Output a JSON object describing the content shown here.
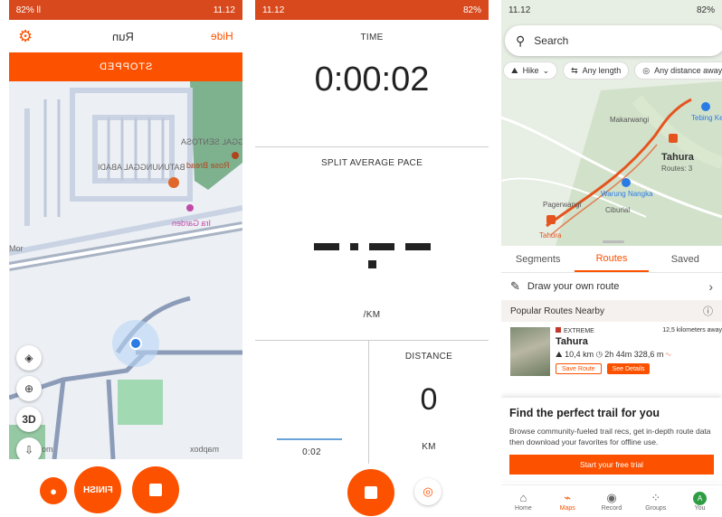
{
  "panel_record_map": {
    "status_left": "11.12",
    "status_right": "82% ll",
    "title": "Run",
    "hide_label": "Hide",
    "stopped_label": "STOPPED",
    "map_labels": {
      "area1": "KATUNUNGGAL SENTOSA",
      "area2": "BATUNUNGGAL ABADI",
      "poi1": "Rose Bread",
      "poi2": "Ira Garden",
      "road": "Mor",
      "poi3": "Telkom",
      "attribution": "mapbox"
    },
    "map_controls": [
      "layers",
      "locate",
      "3D",
      "compass"
    ],
    "finish_label": "FINISH"
  },
  "panel_record_stats": {
    "status_time": "11.12",
    "status_battery": "82%",
    "time_label": "TIME",
    "time_value": "0:00:02",
    "split_label": "SPLIT AVERAGE PACE",
    "pace_unit": "/KM",
    "distance_label": "DISTANCE",
    "distance_value": "0",
    "distance_unit": "KM",
    "split_time": "0:02"
  },
  "panel_maps": {
    "status_time": "11.12",
    "status_battery": "82%",
    "search_placeholder": "Search",
    "chips": [
      {
        "icon": "hike-icon",
        "label": "Hike"
      },
      {
        "icon": "length-icon",
        "label": "Any length"
      },
      {
        "icon": "distance-icon",
        "label": "Any distance away"
      }
    ],
    "map_labels": {
      "makarwangi": "Makarwangi",
      "tebing": "Tebing Ke",
      "tahura_big": "Tahura",
      "tahura_routes": "Routes: 3",
      "pagerwangi": "Pagerwangi",
      "warung": "Warung Nangka",
      "ciburial": "Ciburial",
      "tahura_small": "Tahura"
    },
    "tabs": [
      "Segments",
      "Routes",
      "Saved"
    ],
    "draw_route_label": "Draw your own route",
    "popular_label": "Popular Routes Nearby",
    "route": {
      "difficulty": "EXTREME",
      "distance_away": "12,5 kilometers away",
      "name": "Tahura",
      "length": "10,4 km",
      "duration": "2h 44m",
      "elevation": "328,6 m",
      "save_label": "Save Route",
      "see_label": "See Details"
    },
    "promo": {
      "title": "Find the perfect trail for you",
      "body": "Browse community-fueled trail recs, get in-depth route data then download your favorites for offline use.",
      "button": "Start your free trial"
    },
    "nav": [
      "Home",
      "Maps",
      "Record",
      "Groups",
      "You"
    ],
    "avatar_letter": "A"
  }
}
